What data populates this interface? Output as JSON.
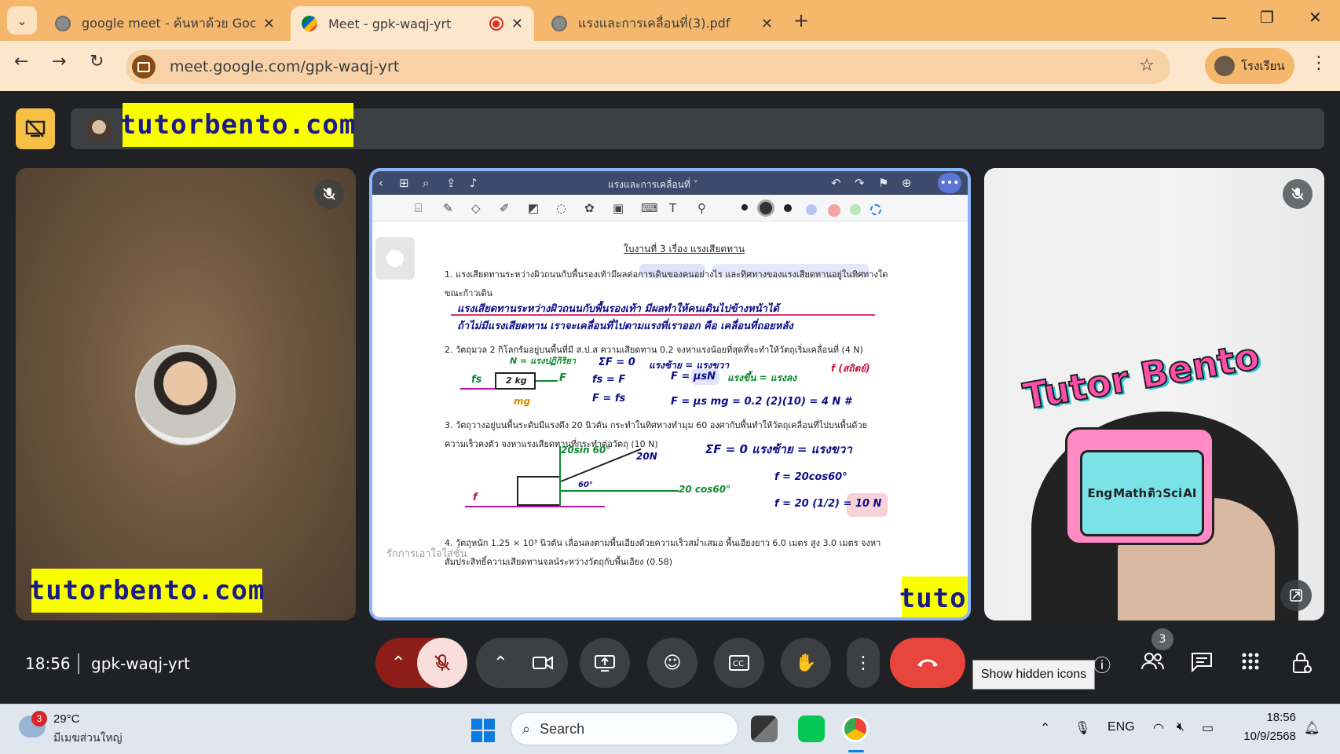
{
  "browser": {
    "tabs": [
      {
        "title": "google meet - ค้นหาด้วย Google",
        "icon": "globe-icon",
        "active": false
      },
      {
        "title": "Meet - gpk-waqj-yrt",
        "icon": "google-meet-icon",
        "active": true,
        "recording": true
      },
      {
        "title": "แรงและการเคลื่อนที่(3).pdf",
        "icon": "globe-icon",
        "active": false
      }
    ],
    "url": "meet.google.com/gpk-waqj-yrt",
    "profile_label": "โรงเรียน",
    "accent": "#f4b76b"
  },
  "meet": {
    "watermark": "tutorbento.com",
    "sticker_title": "Tutor Bento",
    "sticker_labels": [
      "Eng",
      "Math",
      "ติว",
      "Sci",
      "AI"
    ],
    "time": "18:56",
    "meeting_code": "gpk-waqj-yrt",
    "participants_count": "3",
    "tooltip": "Show hidden icons",
    "shared_screen": {
      "app_title": "แรงและการเคลื่อนที่ ˅",
      "worksheet_title": "ใบงานที่ 3 เรื่อง แรงเสียดทาน",
      "questions": [
        "1. แรงเสียดทานระหว่างผิวถนนกับพื้นรองเท้ามีผลต่อการเดินของคนอย่างไร และทิศทางของแรงเสียดทานอยู่ในทิศทางใด",
        "ขณะก้าวเดิน",
        "2. วัตถุมวล 2 กิโลกรัมอยู่บนพื้นที่มี ส.ป.ส ความเสียดทาน 0.2 จงหาแรงน้อยที่สุดที่จะทำให้วัตถุเริ่มเคลื่อนที่ (4 N)",
        "3. วัตถุวางอยู่บนพื้นระดับมีแรงดึง 20 นิวตัน กระทำในทิศทางทำมุม 60 องศากับพื้นทำให้วัตถุเคลื่อนที่ไปบนพื้นด้วย",
        "ความเร็วคงตัว จงหาแรงเสียดทานที่กระทำต่อวัตถุ (10 N)",
        "4. วัตถุหนัก 1.25 × 10³ นิวตัน เลื่อนลงตามพื้นเอียงด้วยความเร็วสม่ำเสมอ พื้นเอียงยาว 6.0 เมตร สูง 3.0 เมตร จงหา",
        "สัมประสิทธิ์ความเสียดทานจลน์ระหว่างวัตถุกับพื้นเอียง (0.58)"
      ],
      "handwriting": [
        "แรงเสียดทานระหว่างผิวถนนกับพื้นรองเท้า มีผลทำให้คนเดินไปข้างหน้าได้",
        "ถ้าไม่มีแรงเสียดทาน เราจะเคลื่อนที่ไปตามแรงที่เราออก คือ เคลื่อนที่ถอยหลัง",
        "N = แรงปฏิกิริยา",
        "ΣF = 0",
        "แรงซ้าย = แรงขวา",
        "f (สถิตย์)",
        "fs",
        "2 kg",
        "F",
        "mg",
        "fs = F",
        "F = μsN",
        "แรงขึ้น = แรงลง",
        "F = fs",
        "F = μs mg = 0.2 (2)(10) = 4 N #",
        "20sin 60°",
        "20N",
        "60°",
        "20 cos60°",
        "f",
        "ΣF = 0   แรงซ้าย = แรงขวา",
        "f = 20cos60°",
        "f = 20 (1/2) = 10 N"
      ],
      "footer": "รักการเอาใจใส่ชั้น"
    }
  },
  "taskbar": {
    "weather_badge": "3",
    "temperature": "29°C",
    "weather_text": "มีเมฆส่วนใหญ่",
    "search_placeholder": "Search",
    "lang": "ENG",
    "clock": "18:56",
    "date": "10/9/2568"
  }
}
